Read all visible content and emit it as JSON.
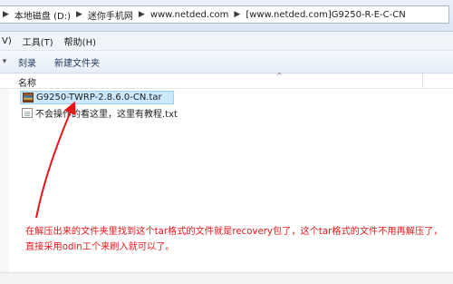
{
  "address": {
    "crumbs": [
      "本地磁盘 (D:)",
      "迷你手机网",
      "www.netded.com",
      "[www.netded.com]G9250-R-E-C-CN"
    ]
  },
  "menu": {
    "view_label": "V)",
    "tools_label": "工具(T)",
    "help_label": "帮助(H)"
  },
  "toolbar": {
    "burn_label": "刻录",
    "new_folder_label": "新建文件夹"
  },
  "list": {
    "column_name": "名称",
    "files": [
      {
        "name": "G9250-TWRP-2.8.6.0-CN.tar",
        "icon": "archive-icon"
      },
      {
        "name": "不会操作的看这里，这里有教程.txt",
        "icon": "text-file-icon"
      }
    ]
  },
  "annotation": {
    "text": "在解压出来的文件夹里找到这个tar格式的文件就是recovery包了，这个tar格式的文件不用再解压了，直接采用odin工个来刷入就可以了。",
    "color": "#e5171b"
  }
}
